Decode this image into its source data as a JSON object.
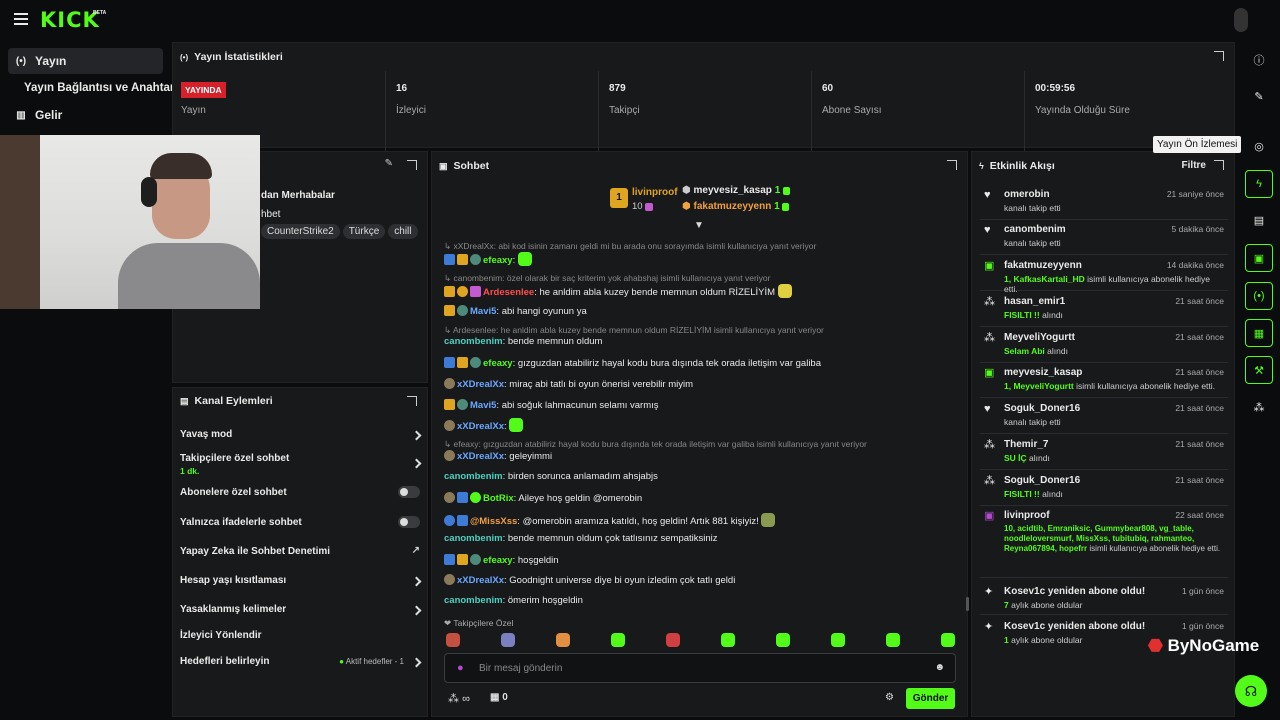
{
  "app": {
    "logo": "KICK",
    "beta": "BETA"
  },
  "leftnav": {
    "items": [
      {
        "label": "Yayın",
        "icon": "broadcast-icon"
      },
      {
        "label": "Yayın Bağlantısı ve Anahtarı",
        "icon": ""
      },
      {
        "label": "Gelir",
        "icon": "chart-icon"
      }
    ]
  },
  "stats": {
    "title": "Yayın İstatistikleri",
    "live_badge": "YAYINDA",
    "items": [
      {
        "value": "",
        "label": "Yayın"
      },
      {
        "value": "16",
        "label": "İzleyici"
      },
      {
        "value": "879",
        "label": "Takipçi"
      },
      {
        "value": "60",
        "label": "Abone Sayısı"
      },
      {
        "value": "00:59:56",
        "label": "Yayında Olduğu Süre"
      }
    ]
  },
  "stream_info": {
    "line1": "dan Merhabalar",
    "line2": "hbet",
    "tags": [
      "CounterStrike2",
      "Türkçe",
      "chill"
    ]
  },
  "actions": {
    "title": "Kanal Eylemleri",
    "items": [
      {
        "label": "Yavaş mod",
        "control": "chevron"
      },
      {
        "label": "Takipçilere özel sohbet",
        "sub": "1 dk.",
        "control": "chevron"
      },
      {
        "label": "Abonelere özel sohbet",
        "control": "toggle"
      },
      {
        "label": "Yalnızca ifadelerle sohbet",
        "control": "toggle"
      },
      {
        "label": "Yapay Zeka ile Sohbet Denetimi",
        "control": "external"
      },
      {
        "label": "Hesap yaşı kısıtlaması",
        "control": "chevron"
      },
      {
        "label": "Yasaklanmış kelimeler",
        "control": "chevron"
      },
      {
        "label": "İzleyici Yönlendir",
        "control": "none"
      },
      {
        "label": "Hedefleri belirleyin",
        "control": "chevron",
        "status": "Aktif hedefler - 1"
      }
    ]
  },
  "chat": {
    "title": "Sohbet",
    "pinned": {
      "first": {
        "rank": "1",
        "name": "livinproof",
        "count": "10"
      },
      "others": [
        {
          "name": "meyvesiz_kasap",
          "count": "1"
        },
        {
          "name": "fakatmuzeyyenn",
          "count": "1"
        }
      ]
    },
    "messages": [
      {
        "reply": "xXDrealXx: abi kod isinin zamanı geldi mi bu arada onu sorayımda isimli kullanıcıya yanıt veriyor"
      },
      {
        "user": "efeaxy",
        "color": "green",
        "text": ""
      },
      {
        "reply": "canombenim: özel olarak bir saç kriterim yok ahabshaj isimli kullanıcıya yanıt veriyor"
      },
      {
        "user": "Ardesenlee",
        "color": "red",
        "text": "he anldim abla kuzey bende memnun oldum RİZELİYİM"
      },
      {
        "user": "Mavi5",
        "color": "blue",
        "text": "abi hangi oyunun ya"
      },
      {
        "reply": "Ardesenlee: he anldim abla kuzey bende memnun oldum RİZELİYİM isimli kullanıcıya yanıt veriyor"
      },
      {
        "user": "canombenim",
        "color": "teal",
        "text": "bende memnun oldum"
      },
      {
        "user": "efeaxy",
        "color": "green",
        "text": "gızguzdan atabiliriz hayal kodu bura dışında tek orada iletişim var galiba"
      },
      {
        "user": "xXDrealXx",
        "color": "blue",
        "text": "miraç abi tatlı bi oyun önerisi verebilir miyim"
      },
      {
        "user": "Mavi5",
        "color": "blue",
        "text": "abi soğuk lahmacunun selamı varmış"
      },
      {
        "user": "xXDrealXx",
        "color": "blue",
        "text": ""
      },
      {
        "reply": "efeaxy: gızguzdan atabiliriz hayal kodu bura dışında tek orada iletişim var galiba isimli kullanıcıya yanıt veriyor"
      },
      {
        "user": "xXDrealXx",
        "color": "blue",
        "text": "geleyimmi"
      },
      {
        "user": "canombenim",
        "color": "teal",
        "text": "birden sorunca anlamadım ahsjabjs"
      },
      {
        "user": "BotRix",
        "color": "green",
        "text": "Aileye hoş geldin @omerobin"
      },
      {
        "user": "@MissXss",
        "color": "orange",
        "text": "@omerobin aramıza katıldı, hoş geldin! Artık 881 kişiyiz!"
      },
      {
        "user": "canombenim",
        "color": "teal",
        "text": "bende memnun oldum çok tatlısınız sempatiksiniz"
      },
      {
        "user": "efeaxy",
        "color": "green",
        "text": "hoşgeldin"
      },
      {
        "user": "xXDrealXx",
        "color": "blue",
        "text": "Goodnight universe diye bi oyun izledim çok tatlı geldi"
      },
      {
        "user": "canombenim",
        "color": "teal",
        "text": "ömerim hoşgeldin"
      }
    ],
    "emote_section": "Takipçilere Özel",
    "input_placeholder": "Bir mesaj gönderin",
    "points": "∞",
    "gifts": "0",
    "send_label": "Gönder"
  },
  "activity": {
    "title": "Etkinlik Akışı",
    "filter": "Filtre",
    "events": [
      {
        "icon": "heart-icon",
        "name": "omerobin",
        "time": "21 saniye önce",
        "sub": "kanalı takip etti"
      },
      {
        "icon": "heart-icon",
        "name": "canombenim",
        "time": "5 dakika önce",
        "sub": "kanalı takip etti"
      },
      {
        "icon": "gift-icon",
        "name": "fakatmuzeyyenn",
        "time": "14 dakika önce",
        "highlight": "1, KafkasKartali_HD",
        "sub": "isimli kullanıcıya abonelik hediye etti."
      },
      {
        "icon": "kicks-icon",
        "name": "hasan_emir1",
        "time": "21 saat önce",
        "highlight": "FISILTI !!",
        "sub": "alındı"
      },
      {
        "icon": "kicks-icon",
        "name": "MeyveliYogurtt",
        "time": "21 saat önce",
        "highlight": "Selam Abi",
        "sub": "alındı"
      },
      {
        "icon": "gift-icon",
        "name": "meyvesiz_kasap",
        "time": "21 saat önce",
        "highlight": "1, MeyveliYogurtt",
        "sub": "isimli kullanıcıya abonelik hediye etti."
      },
      {
        "icon": "heart-icon",
        "name": "Soguk_Doner16",
        "time": "21 saat önce",
        "sub": "kanalı takip etti"
      },
      {
        "icon": "kicks-icon",
        "name": "Themir_7",
        "time": "21 saat önce",
        "highlight": "SU İÇ",
        "sub": "alındı"
      },
      {
        "icon": "kicks-icon",
        "name": "Soguk_Doner16",
        "time": "21 saat önce",
        "highlight": "FISILTI !!",
        "sub": "alındı"
      },
      {
        "icon": "gift-icon",
        "name": "livinproof",
        "time": "22 saat önce",
        "highlight": "10, acidtib, Emraniksic, Gummybear808, vg_table, noodleloversmurf, MissXss, tubitubiq, rahmanteo, Reyna067894, hopefrr",
        "sub": "isimli kullanıcıya abonelik hediye etti."
      },
      {
        "icon": "sparkle-icon",
        "name": "Kosev1c yeniden abone oldu!",
        "time": "1 gün önce",
        "highlight": "7",
        "sub": "aylık abone oldular"
      },
      {
        "icon": "sparkle-icon",
        "name": "Kosev1c yeniden abone oldu!",
        "time": "1 gün önce",
        "highlight": "1",
        "sub": "aylık abone oldular"
      }
    ]
  },
  "rightbar": {
    "tooltip": "Yayın Ön İzlemesi"
  },
  "watermark": "ByNoGame",
  "colors": {
    "accent": "#53fc18",
    "live": "#d6202a",
    "panel": "#18191b",
    "bg": "#0b0c0d"
  }
}
